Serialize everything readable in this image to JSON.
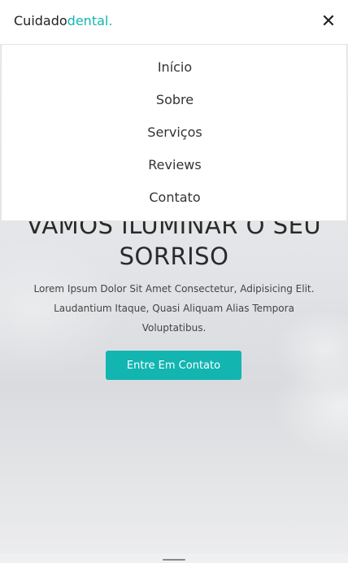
{
  "header": {
    "logo_main": "Cuidado",
    "logo_accent": "dental.",
    "close_icon": "✕"
  },
  "menu": {
    "items": [
      {
        "label": "Início"
      },
      {
        "label": "Sobre"
      },
      {
        "label": "Serviços"
      },
      {
        "label": "Reviews"
      },
      {
        "label": "Contato"
      }
    ]
  },
  "hero": {
    "title_line1": "VAMOS ILUMINAR O SEU",
    "title_line2": "SORRISO",
    "text": "Lorem Ipsum Dolor Sit Amet Consectetur, Adipisicing Elit. Laudantium Itaque, Quasi Aliquam Alias Tempora Voluptatibus.",
    "cta_label": "Entre Em Contato"
  },
  "colors": {
    "accent": "#13b5b1",
    "text_dark": "#2a2a2a"
  }
}
